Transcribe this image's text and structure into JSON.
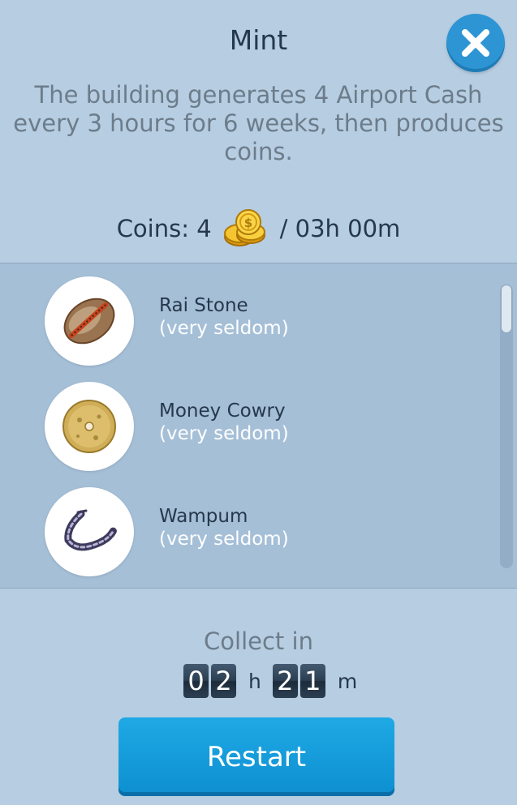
{
  "header": {
    "title": "Mint",
    "close_icon": "close-icon"
  },
  "description": "The building generates 4 Airport Cash every 3 hours for 6 weeks, then produces coins.",
  "production": {
    "coins_label": "Coins: 4",
    "coin_icon": "gold-coins-icon",
    "interval": "/ 03h 00m"
  },
  "drops": [
    {
      "name": "Rai Stone",
      "frequency": "(very seldom)",
      "icon": "cowry-shell-icon"
    },
    {
      "name": "Money Cowry",
      "frequency": "(very seldom)",
      "icon": "stone-disc-icon"
    },
    {
      "name": "Wampum",
      "frequency": "(very seldom)",
      "icon": "bead-string-icon"
    }
  ],
  "collect": {
    "label": "Collect in",
    "hours_digits": [
      "0",
      "2"
    ],
    "hours_unit": "h",
    "minutes_digits": [
      "2",
      "1"
    ],
    "minutes_unit": "m"
  },
  "restart_button": {
    "label": "Restart"
  },
  "colors": {
    "background": "#b6cde2",
    "list_background": "#a5bfd7",
    "accent_blue": "#2d95d4",
    "button_blue": "#1fa9e5",
    "timer_digit_bg": "#2c3f52"
  }
}
